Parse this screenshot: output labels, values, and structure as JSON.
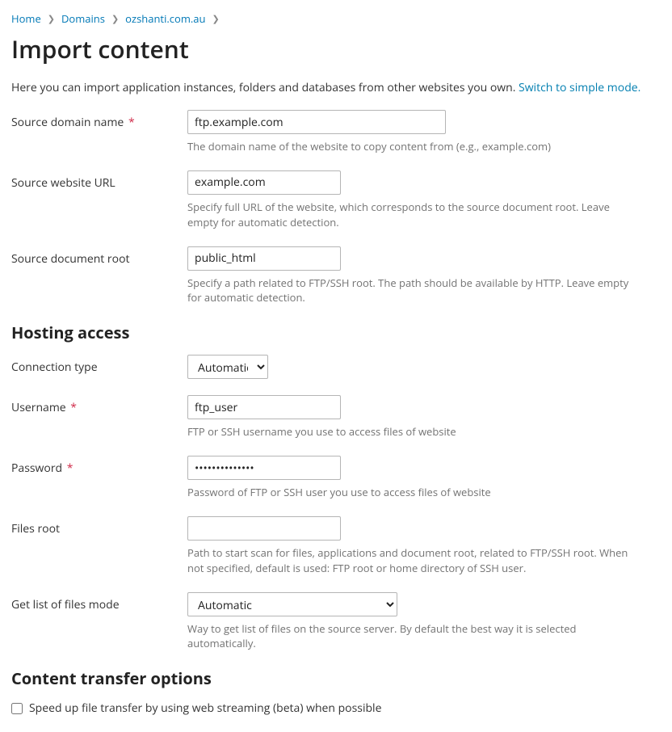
{
  "breadcrumb": {
    "items": [
      {
        "label": "Home"
      },
      {
        "label": "Domains"
      },
      {
        "label": "ozshanti.com.au"
      }
    ]
  },
  "page": {
    "title": "Import content",
    "intro": "Here you can import application instances, folders and databases from other websites you own. ",
    "switch_link": "Switch to simple mode."
  },
  "source": {
    "domain_label": "Source domain name",
    "domain_value": "ftp.example.com",
    "domain_hint": "The domain name of the website to copy content from (e.g., example.com)",
    "url_label": "Source website URL",
    "url_value": "example.com",
    "url_hint": "Specify full URL of the website, which corresponds to the source document root. Leave empty for automatic detection.",
    "docroot_label": "Source document root",
    "docroot_value": "public_html",
    "docroot_hint": "Specify a path related to FTP/SSH root. The path should be available by HTTP. Leave empty for automatic detection."
  },
  "hosting": {
    "heading": "Hosting access",
    "conn_label": "Connection type",
    "conn_selected": "Automatic",
    "user_label": "Username",
    "user_value": "ftp_user",
    "user_hint": "FTP or SSH username you use to access files of website",
    "pass_label": "Password",
    "pass_value": "••••••••••••••",
    "pass_hint": "Password of FTP or SSH user you use to access files of website",
    "filesroot_label": "Files root",
    "filesroot_value": "",
    "filesroot_hint": "Path to start scan for files, applications and document root, related to FTP/SSH root. When not specified, default is used: FTP root or home directory of SSH user.",
    "listmode_label": "Get list of files mode",
    "listmode_selected": "Automatic",
    "listmode_hint": "Way to get list of files on the source server. By default the best way it is selected automatically."
  },
  "transfer": {
    "heading": "Content transfer options",
    "speedup_label": "Speed up file transfer by using web streaming (beta) when possible"
  },
  "required_mark": "*"
}
